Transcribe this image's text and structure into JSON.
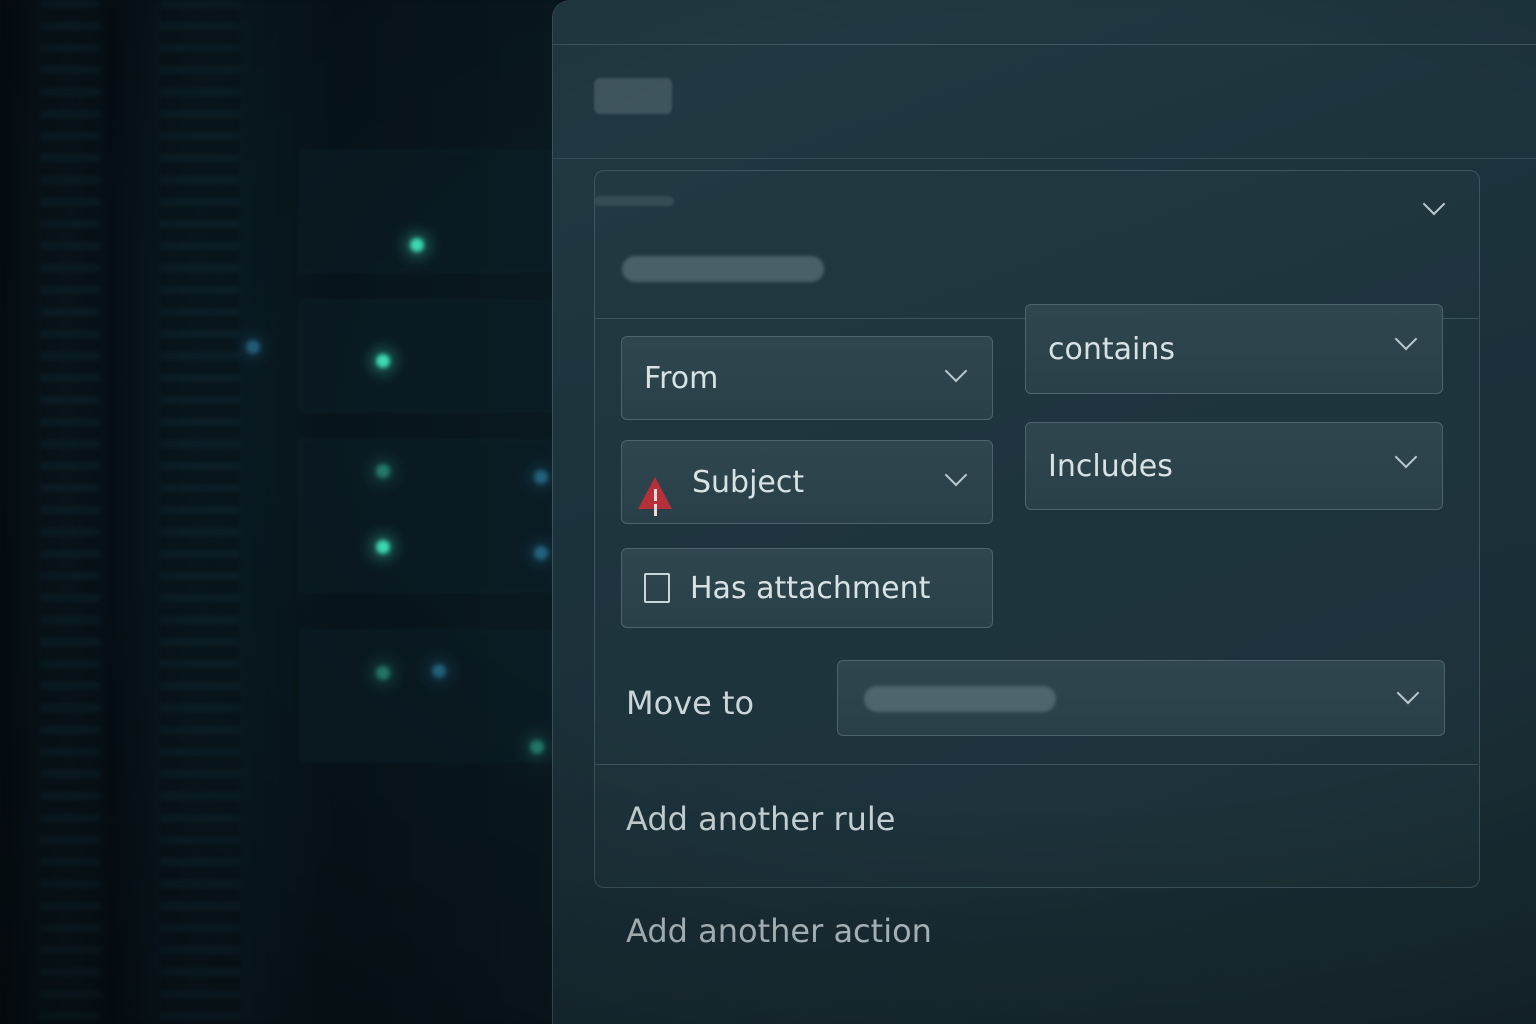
{
  "conditions": {
    "field1": {
      "label": "From"
    },
    "operator1": {
      "label": "contains"
    },
    "field2": {
      "label": "Subject"
    },
    "operator2": {
      "label": "Includes"
    },
    "attachment": {
      "label": "Has attachment",
      "checked": false
    }
  },
  "action": {
    "label": "Move to",
    "destination": ""
  },
  "links": {
    "add_rule": "Add another rule",
    "add_action": "Add another action"
  },
  "icons": {
    "warning": "warning-icon",
    "chevron": "chevron-down-icon"
  },
  "colors": {
    "panel": "#1c323b",
    "warning": "#b5303a",
    "led": "#3ddcb4"
  }
}
